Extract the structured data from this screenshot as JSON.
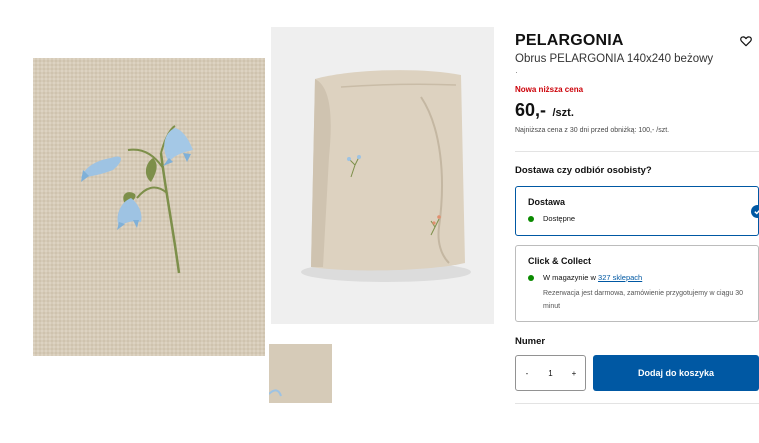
{
  "gallery": {
    "main_image": "embroidered-bluebell-closeup",
    "second_image": "folded-beige-tablecloth",
    "thumbnail": "tablecloth-fabric-thumbnail"
  },
  "product": {
    "name": "PELARGONIA",
    "description": "Obrus PELARGONIA 140x240 beżowy",
    "separator": "·",
    "wishlist_icon": "heart-icon",
    "price_badge": "Nowa niższa cena",
    "price": "60,-",
    "price_unit": "/szt.",
    "lowest_price_note": "Najniższa cena z 30 dni przed obniżką: 100,- /szt."
  },
  "fulfillment": {
    "question": "Dostawa czy odbiór osobisty?",
    "delivery": {
      "title": "Dostawa",
      "status": "Dostępne",
      "selected": true
    },
    "collect": {
      "title": "Click & Collect",
      "status_prefix": "W magazynie w",
      "store_link": "327 sklepach",
      "note": "Rezerwacja jest darmowa, zamówienie przygotujemy w ciągu 30 minut"
    }
  },
  "purchase": {
    "quantity_label": "Numer",
    "decrement": "-",
    "quantity": "1",
    "increment": "+",
    "add_to_cart": "Dodaj do koszyka"
  },
  "colors": {
    "accent": "#0058a3",
    "sale_red": "#cc0008",
    "available_green": "#0a8a00",
    "fabric": "#d8cdbb"
  }
}
